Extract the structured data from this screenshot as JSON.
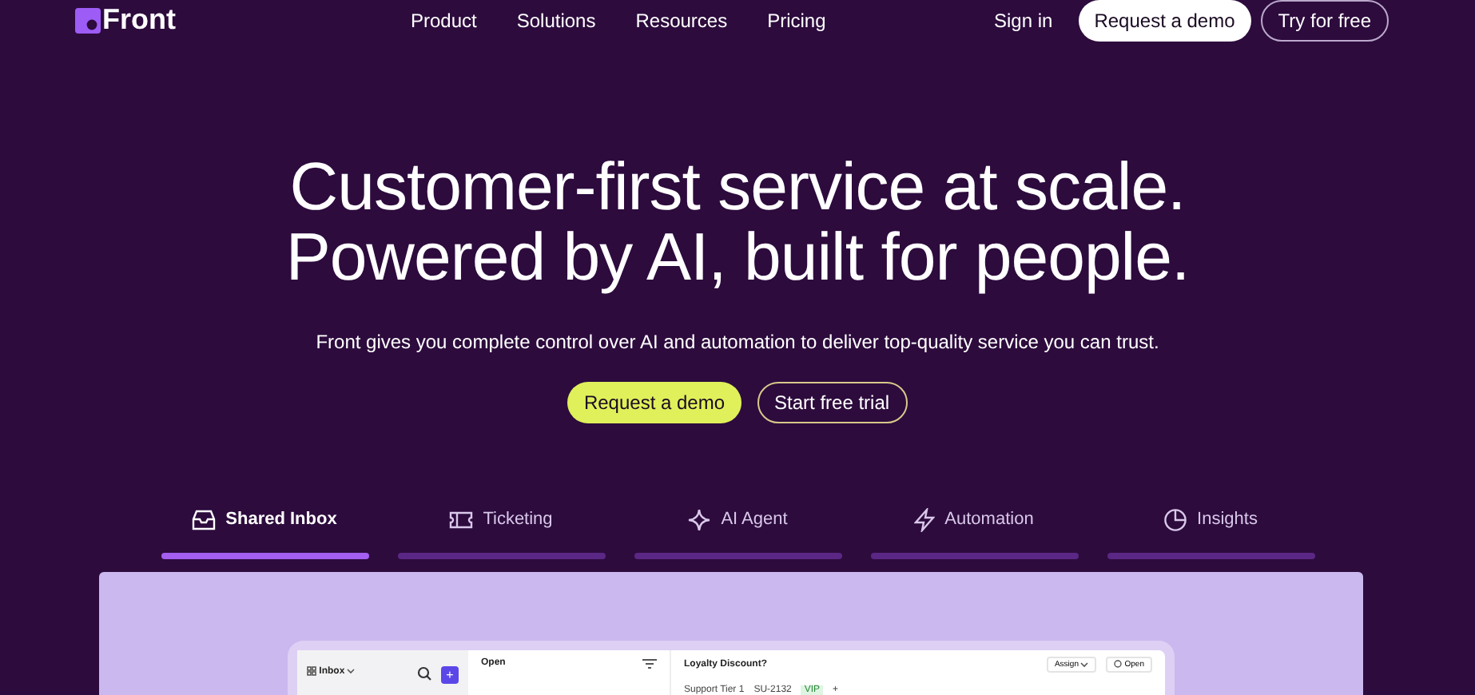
{
  "nav": {
    "logo": "Front",
    "links": [
      "Product",
      "Solutions",
      "Resources",
      "Pricing"
    ],
    "sign_in": "Sign in",
    "demo": "Request a demo",
    "trial": "Try for free"
  },
  "hero": {
    "title_lines": [
      "Customer-first service at scale.",
      "Powered by AI, built for people."
    ],
    "subtitle": "Front gives you complete control over AI and automation to deliver top-quality service you can trust.",
    "primary": "Request a demo",
    "secondary": "Start free trial"
  },
  "tabs": [
    {
      "label": "Shared Inbox",
      "selected": true
    },
    {
      "label": "Ticketing",
      "selected": false
    },
    {
      "label": "AI Agent",
      "selected": false
    },
    {
      "label": "Automation",
      "selected": false
    },
    {
      "label": "Insights",
      "selected": false
    }
  ],
  "app": {
    "inbox": "Inbox",
    "list_title": "Open",
    "subject": "Loyalty Discount?",
    "assign": "Assign",
    "status": "Open",
    "team": "Support Tier 1",
    "ticket_id": "SU-2132",
    "tag": "VIP",
    "add": "+"
  }
}
